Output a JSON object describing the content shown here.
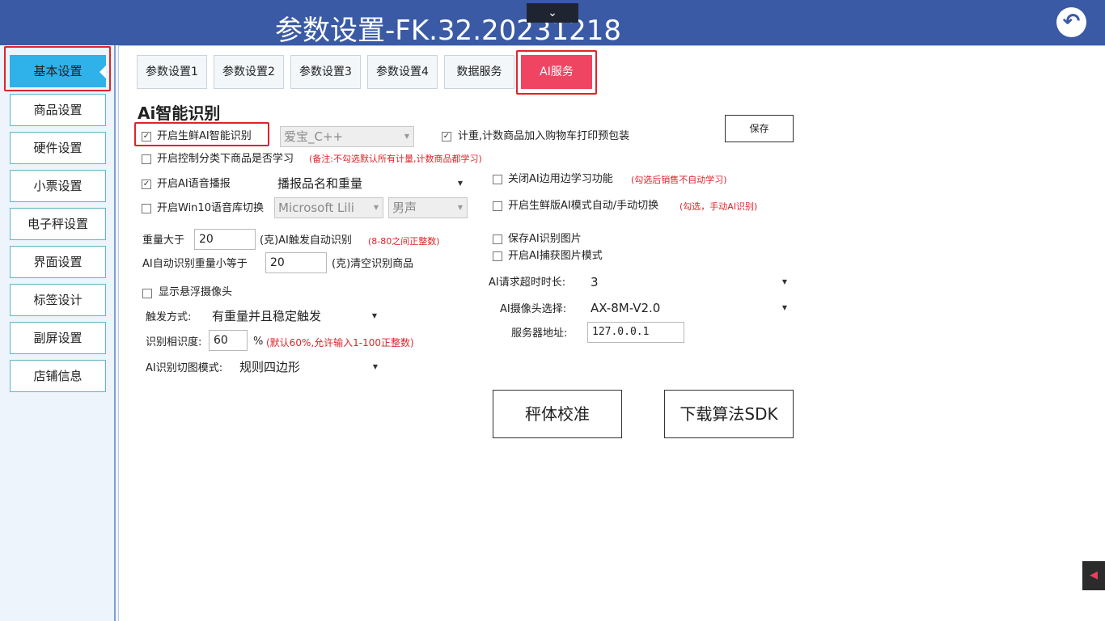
{
  "window": {
    "title": "参数设置-FK.32.20231218"
  },
  "sidebar": {
    "items": [
      "基本设置",
      "商品设置",
      "硬件设置",
      "小票设置",
      "电子秤设置",
      "界面设置",
      "标签设计",
      "副屏设置",
      "店铺信息"
    ]
  },
  "tabs": [
    "参数设置1",
    "参数设置2",
    "参数设置3",
    "参数设置4",
    "数据服务",
    "AI服务"
  ],
  "section_title": "Ai智能识别",
  "save_label": "保存",
  "left": {
    "fresh_ai_label": "开启生鲜AI智能识别",
    "engine_select": "爱宝_C++",
    "control_learn_label": "开启控制分类下商品是否学习",
    "control_learn_note": "(备注:不勾选默认所有计量,计数商品都学习)",
    "voice_label": "开启AI语音播报",
    "voice_select": "播报品名和重量",
    "win10_label": "开启Win10语音库切换",
    "voice_lib_select": "Microsoft Lili",
    "voice_gender_select": "男声",
    "weight_gt_label": "重量大于",
    "weight_gt_value": "20",
    "weight_gt_suffix": "(克)AI触发自动识别",
    "weight_gt_note": "(8-80之间正整数)",
    "weight_le_label": "AI自动识别重量小等于",
    "weight_le_value": "20",
    "weight_le_suffix": "(克)清空识别商品",
    "float_camera_label": "显示悬浮摄像头",
    "trigger_label": "触发方式:",
    "trigger_select": "有重量并且稳定触发",
    "similarity_label": "识别相识度:",
    "similarity_value": "60",
    "similarity_unit": "%",
    "similarity_note": "(默认60%,允许输入1-100正整数)",
    "crop_label": "AI识别切图模式:",
    "crop_select": "规则四边形"
  },
  "right": {
    "count_label": "计重,计数商品加入购物车打印预包装",
    "close_learn_label": "关闭AI边用边学习功能",
    "close_learn_note": "(勾选后销售不自动学习)",
    "mode_switch_label": "开启生鲜版AI模式自动/手动切换",
    "mode_switch_note": "(勾选，手动AI识别)",
    "save_image_label": "保存AI识别图片",
    "capture_mode_label": "开启AI捕获图片模式",
    "timeout_label": "AI请求超时时长:",
    "timeout_select": "3",
    "camera_label": "AI摄像头选择:",
    "camera_select": "AX-8M-V2.0",
    "server_label": "服务器地址:",
    "server_value": "127.0.0.1"
  },
  "buttons": {
    "calibrate": "秤体校准",
    "sdk": "下载算法SDK"
  },
  "checks": {
    "fresh_ai": true,
    "count": true,
    "control_learn": false,
    "voice": true,
    "win10": false,
    "close_learn": false,
    "mode_switch": false,
    "save_image": false,
    "capture_mode": false,
    "float_camera": false
  },
  "colors": {
    "header": "#3a5aa6",
    "active_side": "#2fb1ea",
    "active_tab": "#ef4563",
    "highlight": "#e0232b",
    "note": "#e0232b"
  },
  "icons": {
    "back": "undo-arrow-icon",
    "dropdown": "chevron-down-icon",
    "corner": "app-tray-icon"
  }
}
